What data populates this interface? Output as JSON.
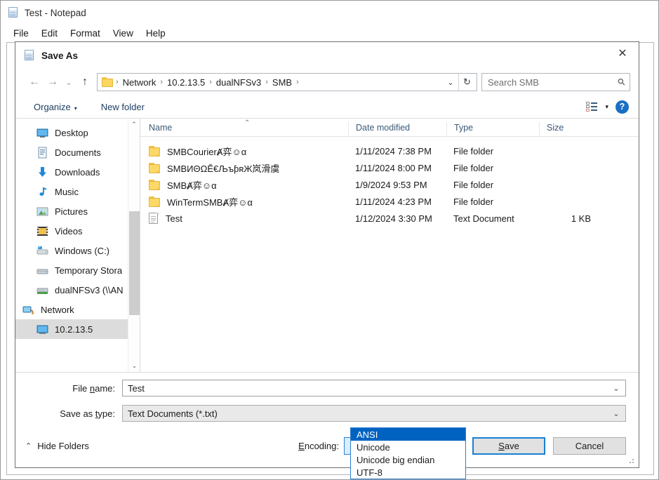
{
  "notepad": {
    "title": "Test - Notepad",
    "icon": "notepad-icon",
    "menus": [
      "File",
      "Edit",
      "Format",
      "View",
      "Help"
    ]
  },
  "dialog": {
    "title": "Save As",
    "icon": "notepad-icon",
    "close_label": "✕",
    "nav": {
      "back": "←",
      "forward": "→",
      "recent": "⌄",
      "up": "↑",
      "refresh": "↻",
      "dropdown": "⌄"
    },
    "breadcrumb": {
      "folder_icon": "folder-icon",
      "items": [
        "Network",
        "10.2.13.5",
        "dualNFSv3",
        "SMB"
      ],
      "separator": "›"
    },
    "search": {
      "placeholder": "Search SMB",
      "icon": "search-icon"
    },
    "toolbar": {
      "organize": "Organize",
      "organize_caret": "▾",
      "new_folder": "New folder",
      "view_icon": "view-layout-icon",
      "view_caret": "▾",
      "help": "?"
    },
    "navpane": {
      "items": [
        {
          "label": "Desktop",
          "icon": "desktop-icon",
          "level": "child",
          "selected": false
        },
        {
          "label": "Documents",
          "icon": "documents-icon",
          "level": "child",
          "selected": false
        },
        {
          "label": "Downloads",
          "icon": "downloads-icon",
          "level": "child",
          "selected": false
        },
        {
          "label": "Music",
          "icon": "music-icon",
          "level": "child",
          "selected": false
        },
        {
          "label": "Pictures",
          "icon": "pictures-icon",
          "level": "child",
          "selected": false
        },
        {
          "label": "Videos",
          "icon": "videos-icon",
          "level": "child",
          "selected": false
        },
        {
          "label": "Windows (C:)",
          "icon": "drive-icon",
          "level": "child",
          "selected": false
        },
        {
          "label": "Temporary Stora",
          "icon": "drive-icon",
          "level": "child",
          "selected": false
        },
        {
          "label": "dualNFSv3 (\\\\AN",
          "icon": "network-drive-icon",
          "level": "child",
          "selected": false
        },
        {
          "label": "Network",
          "icon": "network-icon",
          "level": "root",
          "selected": false
        },
        {
          "label": "10.2.13.5",
          "icon": "computer-icon",
          "level": "child",
          "selected": true
        }
      ],
      "scroll_up": "⌃",
      "scroll_down": "⌄"
    },
    "filelist": {
      "columns": [
        "Name",
        "Date modified",
        "Type",
        "Size"
      ],
      "sort_indicator": "⌃",
      "rows": [
        {
          "icon": "folder-icon",
          "name": "SMBCourierȺ弈☺α",
          "date": "1/11/2024 7:38 PM",
          "type": "File folder",
          "size": ""
        },
        {
          "icon": "folder-icon",
          "name": "SMBИΘΩĔ€ЉъƥʀЖ岚滑虞",
          "date": "1/11/2024 8:00 PM",
          "type": "File folder",
          "size": ""
        },
        {
          "icon": "folder-icon",
          "name": "SMBȺ弈☺α",
          "date": "1/9/2024 9:53 PM",
          "type": "File folder",
          "size": ""
        },
        {
          "icon": "folder-icon",
          "name": "WinTermSMBȺ弈☺α",
          "date": "1/11/2024 4:23 PM",
          "type": "File folder",
          "size": ""
        },
        {
          "icon": "document-icon",
          "name": "Test",
          "date": "1/12/2024 3:30 PM",
          "type": "Text Document",
          "size": "1 KB"
        }
      ]
    },
    "form": {
      "filename_label_a": "File ",
      "filename_label_u": "n",
      "filename_label_b": "ame:",
      "filename_value": "Test",
      "savetype_label_a": "Save as ",
      "savetype_label_u": "t",
      "savetype_label_b": "ype:",
      "savetype_value": "Text Documents (*.txt)",
      "combo_chevron": "⌄"
    },
    "footer": {
      "hide_folders": "Hide Folders",
      "hide_folders_chevron": "⌃",
      "encoding_label_u": "E",
      "encoding_label_b": "ncoding:",
      "encoding_value": "ANSI",
      "encoding_chevron": "⌄",
      "encoding_options": [
        "ANSI",
        "Unicode",
        "Unicode big endian",
        "UTF-8"
      ],
      "encoding_selected_index": 0,
      "save_label_u": "S",
      "save_label_b": "ave",
      "cancel_label": "Cancel"
    }
  },
  "colors": {
    "accent": "#0062c0",
    "focus_border": "#2a7fd4",
    "combo_focus_bg": "#dbeefb",
    "selection_gray": "#dcdcdc",
    "folder_yellow": "#fcd966",
    "header_text": "#3c5a78"
  }
}
